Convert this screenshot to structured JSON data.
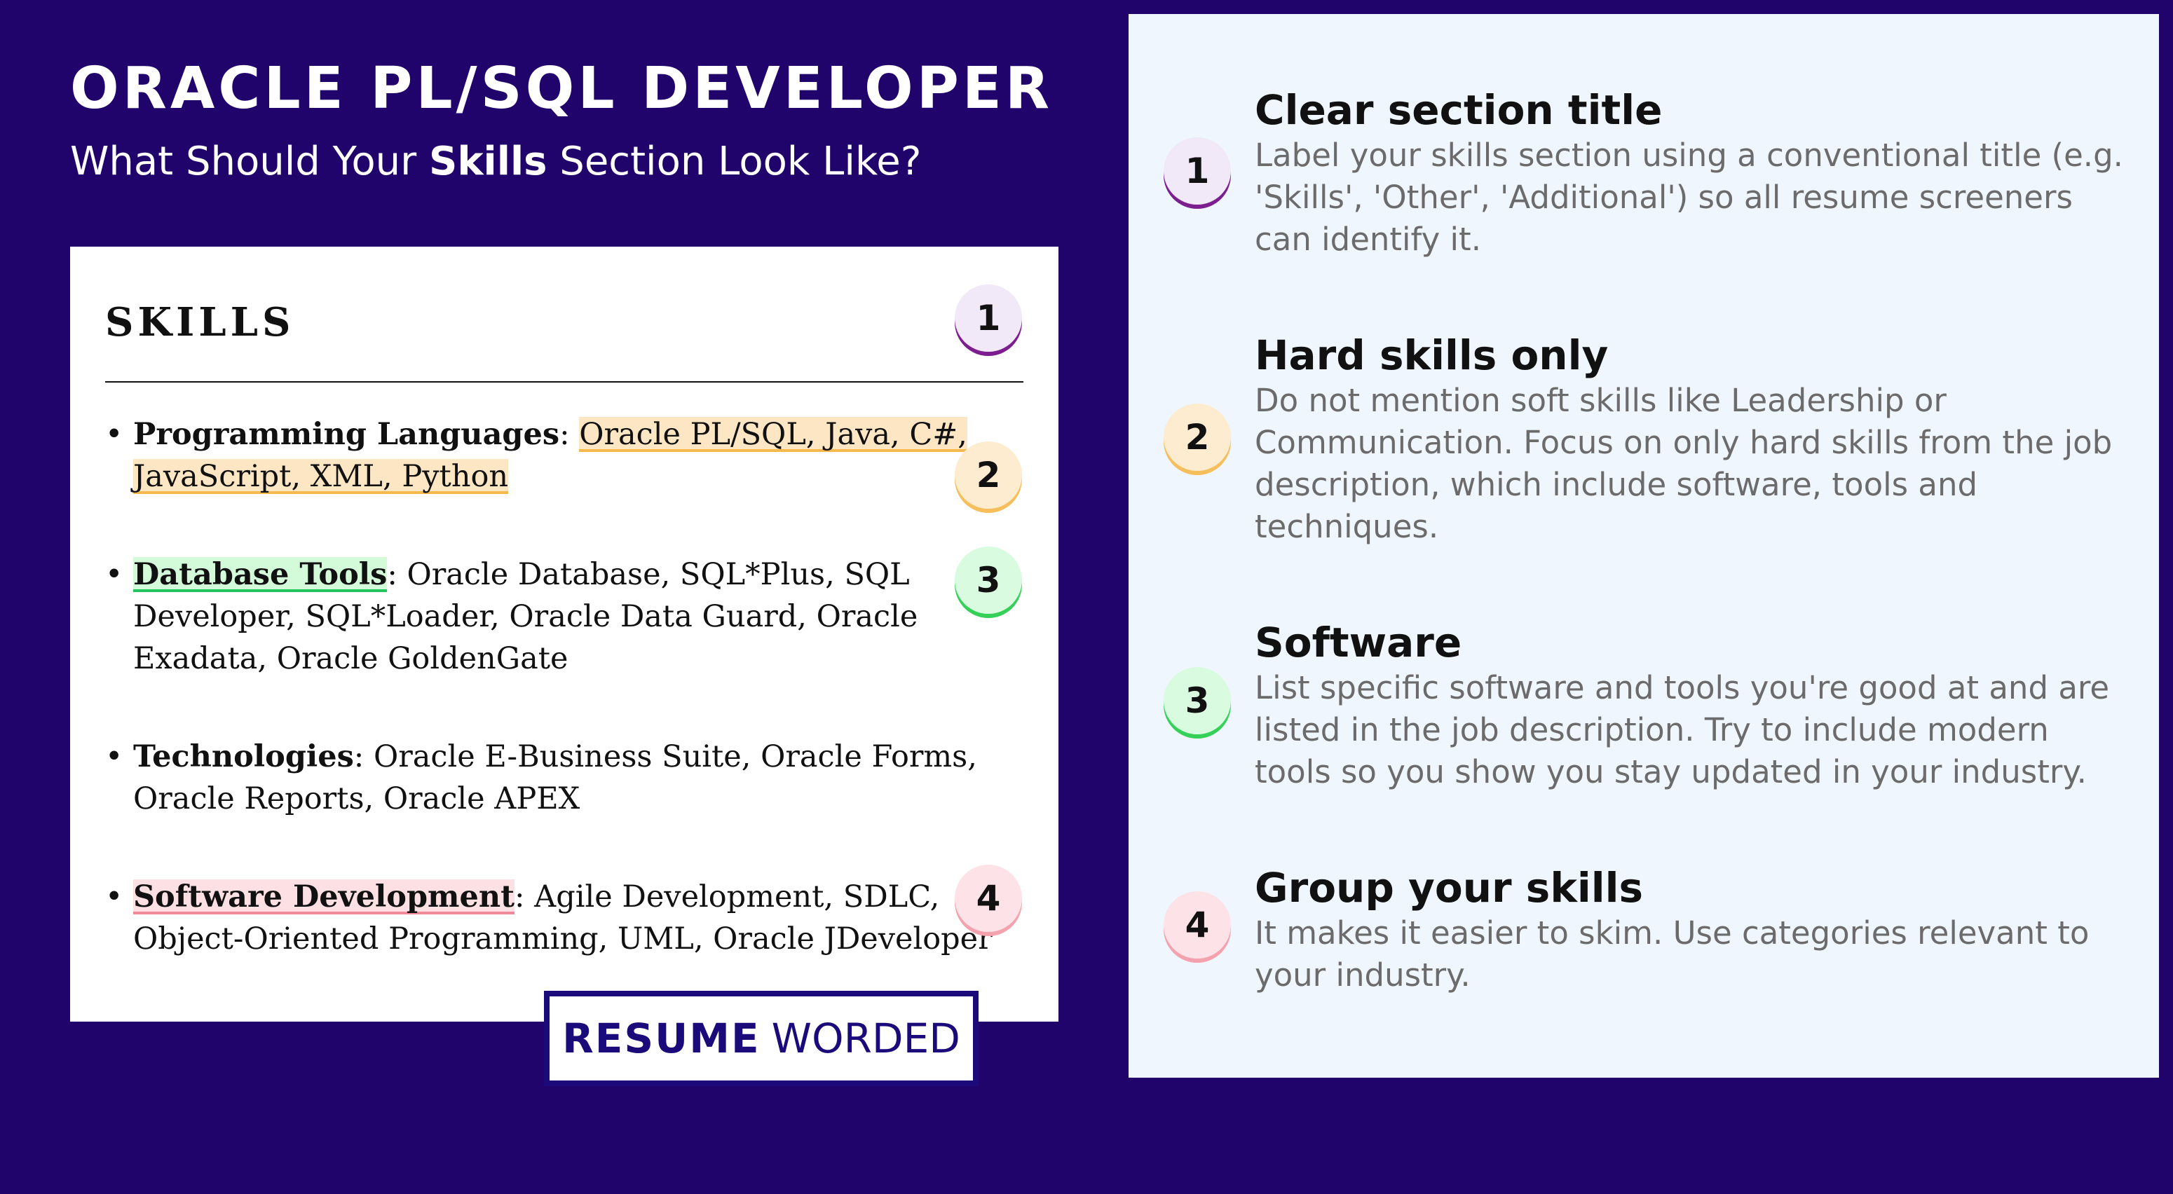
{
  "header": {
    "title": "ORACLE PL/SQL DEVELOPER",
    "subtitle_before": "What Should Your ",
    "subtitle_emphasis": "Skills",
    "subtitle_after": " Section Look Like?"
  },
  "resume": {
    "heading": "SKILLS",
    "items": [
      {
        "category": "Programming Languages",
        "separator": ": ",
        "highlighted_text": "Oracle PL/SQL, Java, C#, JavaScript, XML, Python",
        "text": ""
      },
      {
        "category": "Database Tools",
        "separator": ": ",
        "highlighted_text": "",
        "text": "Oracle Database, SQL*Plus, SQL Developer, SQL*Loader, Oracle Data Guard, Oracle Exadata, Oracle GoldenGate"
      },
      {
        "category": "Technologies",
        "separator": ": ",
        "highlighted_text": "",
        "text": "Oracle E-Business Suite, Oracle Forms, Oracle Reports, Oracle APEX"
      },
      {
        "category": "Software Development",
        "separator": ": ",
        "highlighted_text": "",
        "text": "Agile Development, SDLC, Object-Oriented Programming, UML, Oracle JDeveloper"
      }
    ],
    "bullet": "•",
    "badges": [
      "1",
      "2",
      "3",
      "4"
    ]
  },
  "logo": {
    "strong": "RESUME",
    "light": "WORDED"
  },
  "tips": [
    {
      "number": "1",
      "title": "Clear section title",
      "text": "Label your skills section using a conventional title (e.g. 'Skills', 'Other', 'Additional') so all resume screeners can identify it."
    },
    {
      "number": "2",
      "title": "Hard skills only",
      "text": "Do not mention soft skills like Leadership or Communication. Focus on only hard skills from the job description, which include software, tools and techniques."
    },
    {
      "number": "3",
      "title": "Software",
      "text": "List specific software and tools you're good at and are listed in the job description. Try to include modern tools so you show you stay updated in your industry."
    },
    {
      "number": "4",
      "title": "Group your skills",
      "text": "It makes it easier to skim. Use categories relevant to your industry."
    }
  ],
  "colors": {
    "background": "#20036b",
    "panel": "#eff6fd",
    "badge_1": "#7c1e8e",
    "badge_2": "#f7bf5c",
    "badge_3": "#34d058",
    "badge_4": "#f4a3ae"
  }
}
